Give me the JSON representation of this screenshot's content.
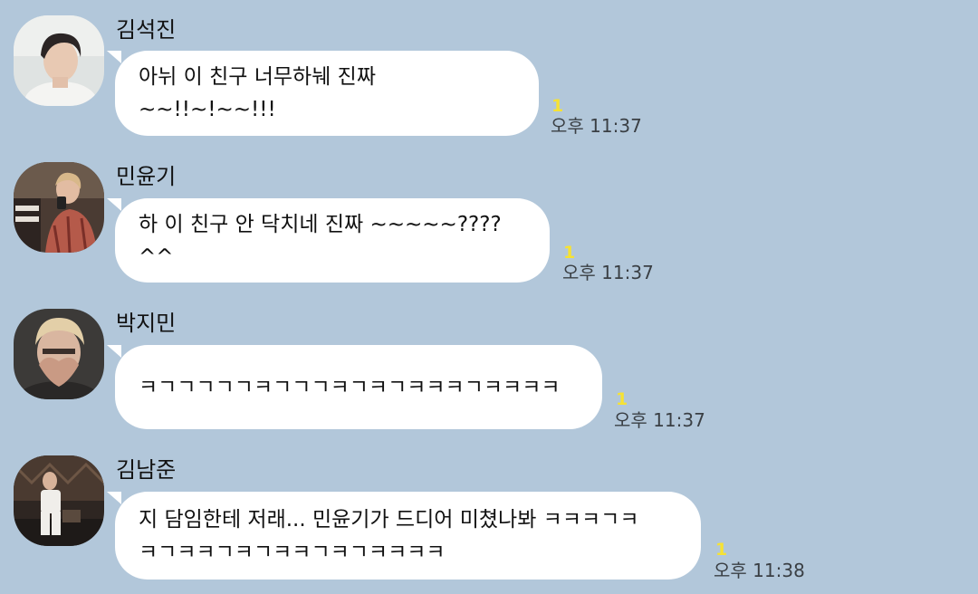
{
  "colors": {
    "background": "#b2c7da",
    "bubble": "#ffffff",
    "unread": "#f6e233",
    "time": "#3a3f44"
  },
  "messages": [
    {
      "sender": "김석진",
      "text": "아뉘 이 친구 너무하눼 진짜 ~~!!~!~~!!!",
      "unread": "1",
      "time": "오후 11:37",
      "avatar": "profile-photo"
    },
    {
      "sender": "민윤기",
      "text": "하 이 친구 안 닥치네 진짜 ~~~~~???? ^^",
      "unread": "1",
      "time": "오후 11:37",
      "avatar": "profile-photo"
    },
    {
      "sender": "박지민",
      "text": "ㅋㄱㄱㄱㄱㄱㅋㄱㄱㄱㅋㄱㅋㄱㅋㅋㅋㄱㅋㅋㅋㅋ",
      "unread": "1",
      "time": "오후 11:37",
      "avatar": "profile-photo"
    },
    {
      "sender": "김남준",
      "text": "지 담임한테 저래... 민윤기가 드디어 미쳤나봐 ㅋㅋㅋㄱㅋ\nㅋㄱㅋㅋㄱㅋㄱㅋㅋㄱㅋㄱㅋㅋㅋㅋ",
      "unread": "1",
      "time": "오후 11:38",
      "avatar": "profile-photo"
    }
  ]
}
